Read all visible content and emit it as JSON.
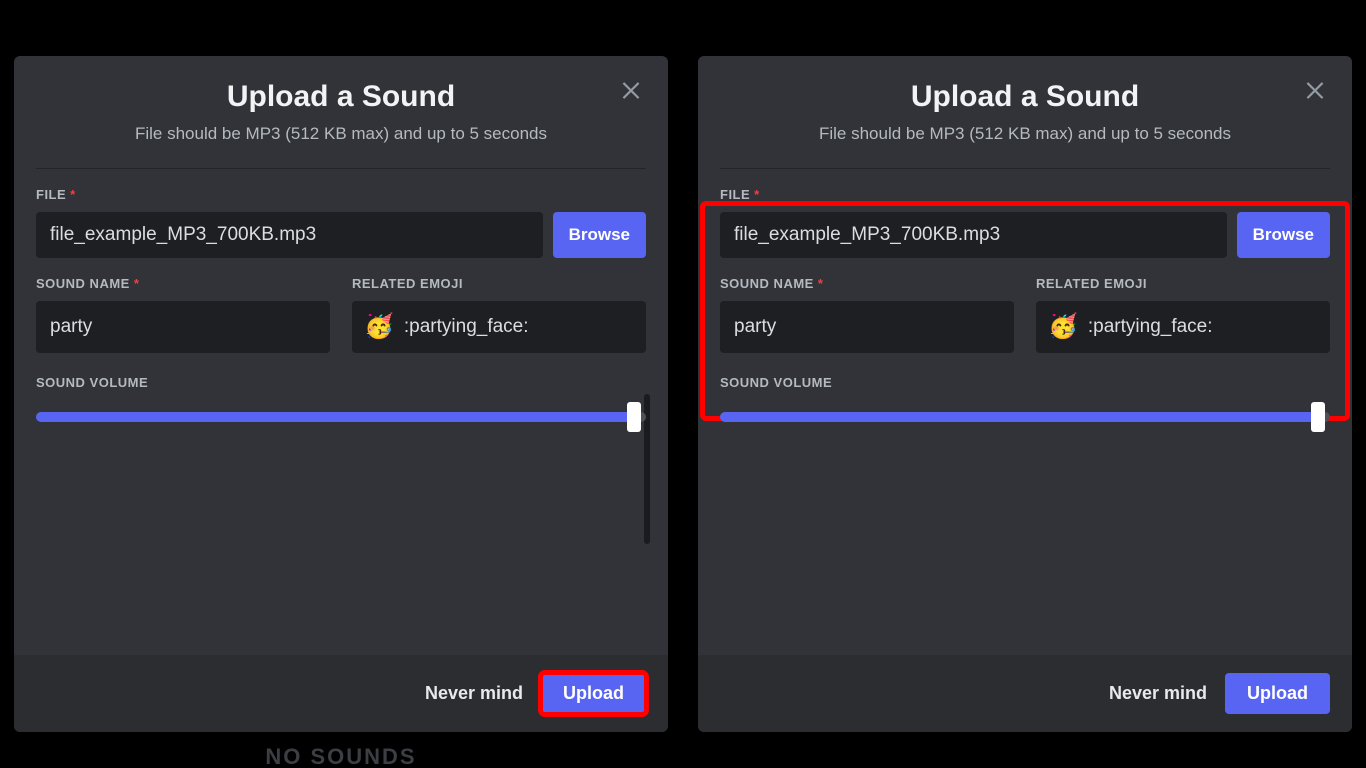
{
  "dialog": {
    "title": "Upload a Sound",
    "subtitle": "File should be MP3 (512 KB max) and up to 5 seconds",
    "file_label": "FILE",
    "file_value": "file_example_MP3_700KB.mp3",
    "browse_label": "Browse",
    "sound_name_label": "SOUND NAME",
    "sound_name_value": "party",
    "emoji_label": "RELATED EMOJI",
    "emoji_glyph": "🥳",
    "emoji_code": ":partying_face:",
    "volume_label": "SOUND VOLUME",
    "volume_percent": 98,
    "nevermind_label": "Never mind",
    "upload_label": "Upload"
  },
  "background_text": "NO SOUNDS",
  "panels": {
    "left": {
      "highlight": "upload-button"
    },
    "right": {
      "highlight": "form-fields"
    }
  }
}
